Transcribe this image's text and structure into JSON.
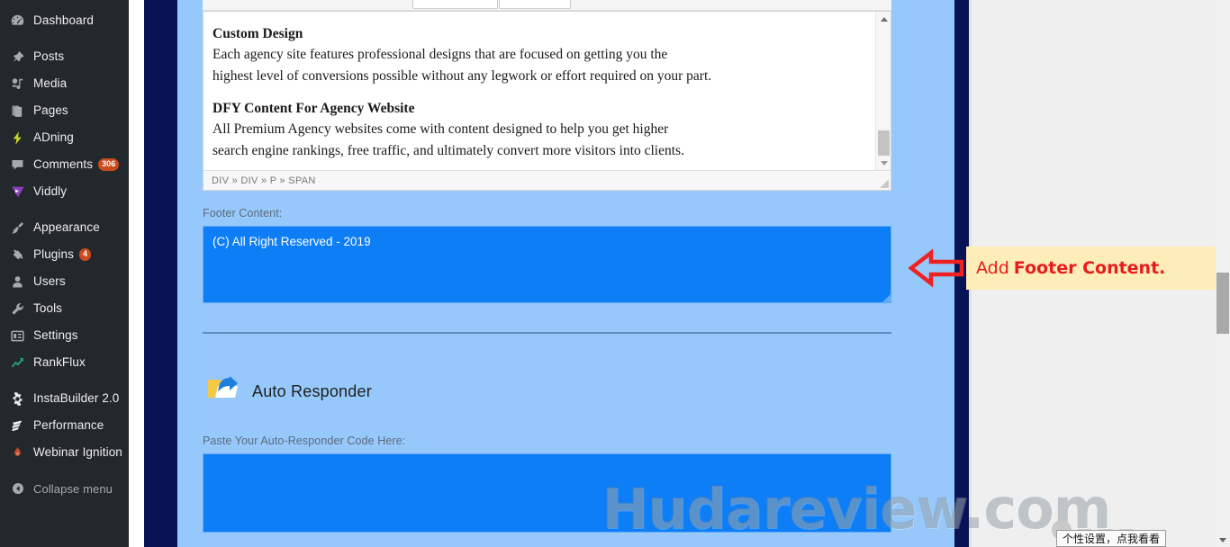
{
  "sidebar": {
    "items": [
      {
        "label": "Dashboard",
        "icon": "dashboard-icon",
        "badge": null
      },
      {
        "label": "Posts",
        "icon": "pin-icon",
        "badge": null
      },
      {
        "label": "Media",
        "icon": "media-icon",
        "badge": null
      },
      {
        "label": "Pages",
        "icon": "pages-icon",
        "badge": null
      },
      {
        "label": "ADning",
        "icon": "lightning-bolt-icon",
        "badge": null
      },
      {
        "label": "Comments",
        "icon": "comment-bubble-icon",
        "badge": "306"
      },
      {
        "label": "Viddly",
        "icon": "play-triangle-icon",
        "badge": null
      },
      {
        "label": "Appearance",
        "icon": "paint-brush-icon",
        "badge": null
      },
      {
        "label": "Plugins",
        "icon": "plug-icon",
        "badge": "4"
      },
      {
        "label": "Users",
        "icon": "user-icon",
        "badge": null
      },
      {
        "label": "Tools",
        "icon": "wrench-icon",
        "badge": null
      },
      {
        "label": "Settings",
        "icon": "sliders-icon",
        "badge": null
      },
      {
        "label": "RankFlux",
        "icon": "trend-arrow-icon",
        "badge": null
      },
      {
        "label": "InstaBuilder 2.0",
        "icon": "gear-icon",
        "badge": null
      },
      {
        "label": "Performance",
        "icon": "speed-icon",
        "badge": null
      },
      {
        "label": "Webinar Ignition",
        "icon": "flame-icon",
        "badge": null
      }
    ],
    "collapse": {
      "label": "Collapse menu",
      "icon": "collapse-left-icon"
    }
  },
  "editor": {
    "blocks": [
      {
        "heading": "Custom Design",
        "lines": [
          "Each agency site features professional designs that are focused on getting you the",
          "highest level of conversions possible without any legwork or effort required on your part."
        ]
      },
      {
        "heading": "DFY Content For Agency Website",
        "lines": [
          "All Premium Agency websites come with content designed to help you get higher",
          "search engine rankings, free traffic, and ultimately convert more visitors into clients."
        ]
      }
    ],
    "path": "DIV » DIV » P » SPAN"
  },
  "footer_section": {
    "label": "Footer Content:",
    "value": "(C) All Right Reserved - 2019",
    "placeholder": "Footer Content"
  },
  "auto_responder": {
    "title": "Auto Responder",
    "icon": "auto-responder-reply-icon",
    "code_label": "Paste Your Auto-Responder Code Here:",
    "code_value": "",
    "code_placeholder": "Paste Your Auto-Responder Code Here"
  },
  "annotation": {
    "prefix": "Add",
    "emphasis": "Footer Content.",
    "arrow_icon": "left-arrow-annotation-icon",
    "box_color": "#fdedb8",
    "text_color": "#e81c1c"
  },
  "watermark": {
    "text": "Hudareview.com"
  },
  "status_tip": {
    "text": "个性设置，点我看看"
  },
  "colors": {
    "sidebar_bg": "#23282d",
    "navy_band": "#071354",
    "content_bg": "#96c8fb",
    "field_blue": "#0d7ef5",
    "badge_orange": "#ca4a1f",
    "annotation_red": "#e81c1c",
    "annotation_bg": "#fdedb8"
  }
}
